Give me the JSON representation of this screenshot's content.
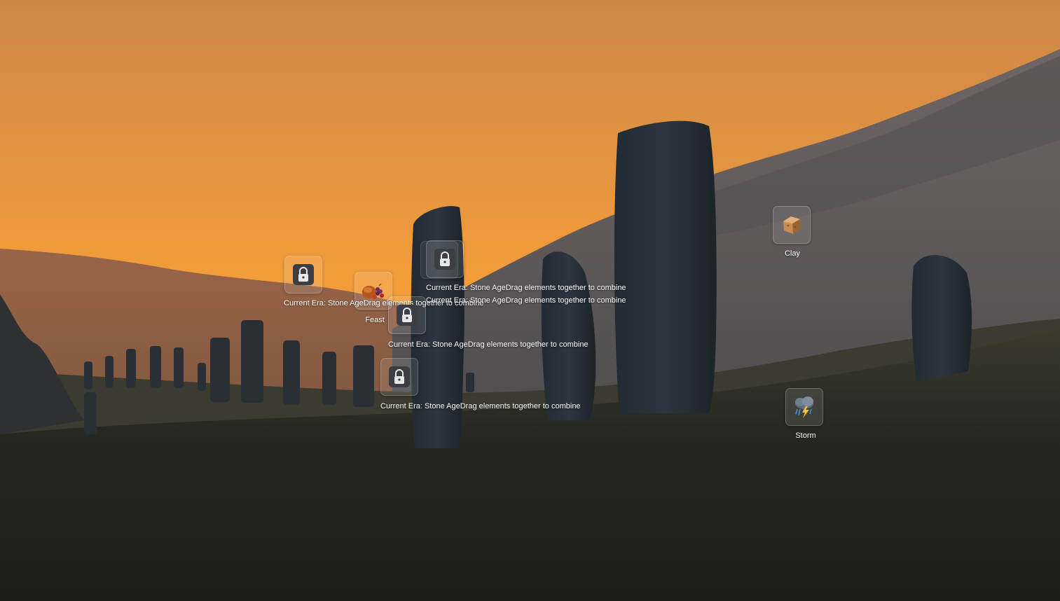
{
  "background": {
    "scene": "stone-circle-sunset",
    "sky_top": "#d18846",
    "sky_mid": "#f49f3a",
    "hill_dark": "#232420"
  },
  "elements": [
    {
      "name": "Clay",
      "icon": "clay-icon",
      "label": "Clay"
    },
    {
      "name": "Feast",
      "icon": "feast-icon",
      "label": "Feast"
    },
    {
      "name": "Storm",
      "icon": "storm-icon",
      "label": "Storm"
    }
  ],
  "locked_tiles": [
    {
      "icon": "lock-icon",
      "era_label": "Current Era: Stone Age",
      "hint": "Drag elements together to combine"
    },
    {
      "icon": "lock-icon",
      "era_label": "Current Era: Stone Age",
      "hint": "Drag elements together to combine"
    },
    {
      "icon": "lock-icon",
      "era_label": "Current Era: Stone Age",
      "hint": "Drag elements together to combine"
    },
    {
      "icon": "lock-icon",
      "era_label": "Current Era: Stone Age",
      "hint": "Drag elements together to combine"
    },
    {
      "icon": "lock-icon",
      "era_label": "Current Era: Stone Age",
      "hint": "Drag elements together to combine"
    }
  ]
}
